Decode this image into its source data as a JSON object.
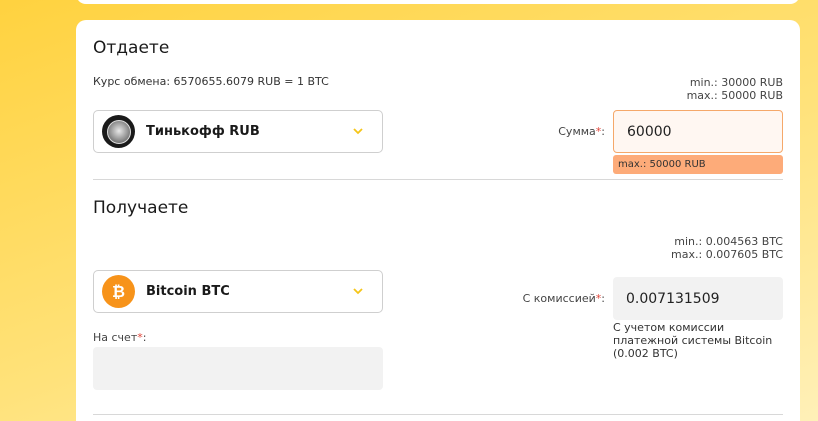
{
  "give": {
    "title": "Отдаете",
    "rate": "Курс обмена: 6570655.6079 RUB = 1 BTC",
    "min": "min.: 30000 RUB",
    "max": "max.: 50000 RUB",
    "currency": "Тинькофф RUB",
    "amount_label": "Сумма",
    "amount_value": "60000",
    "error": "max.: 50000 RUB"
  },
  "receive": {
    "title": "Получаете",
    "min": "min.: 0.004563 BTC",
    "max": "max.: 0.007605 BTC",
    "currency": "Bitcoin BTC",
    "fee_label": "С комиссией",
    "fee_value": "0.007131509",
    "fee_note": "С учетом комиссии платежной системы Bitcoin (0.002 BTC)",
    "account_label": "На счет",
    "account_value": ""
  },
  "icons": {
    "bank": "tinkoff-logo-icon",
    "coin": "bitcoin-icon",
    "dropdown": "chevron-down-icon"
  },
  "colors": {
    "accent": "#f5c518",
    "error_bg": "#fdab79",
    "btc": "#f7931a"
  }
}
